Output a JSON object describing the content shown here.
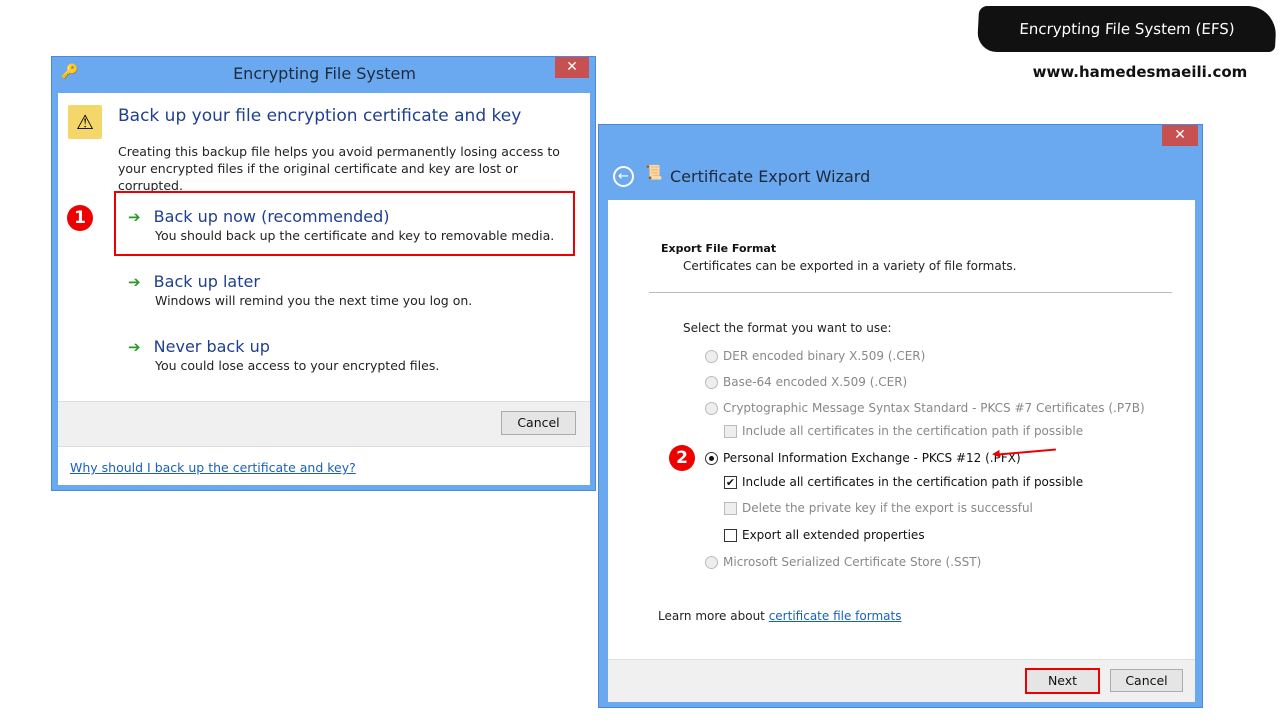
{
  "banner": {
    "title": "Encrypting File System (EFS)",
    "url": "www.hamedesmaeili.com"
  },
  "efs": {
    "title": "Encrypting File System",
    "close": "✕",
    "heading": "Back up your file encryption certificate and key",
    "description": "Creating this backup file helps you avoid permanently losing access to your encrypted files if the original certificate and key are lost or corrupted.",
    "step": "1",
    "options": [
      {
        "label": "Back up now (recommended)",
        "desc": "You should back up the certificate and key to removable media."
      },
      {
        "label": "Back up later",
        "desc": "Windows will remind you the next time you log on."
      },
      {
        "label": "Never back up",
        "desc": "You could lose access to your encrypted files."
      }
    ],
    "cancel": "Cancel",
    "help_link": "Why should I back up the certificate and key?"
  },
  "wizard": {
    "title": "Certificate Export Wizard",
    "close": "✕",
    "section_title": "Export File Format",
    "section_desc": "Certificates can be exported in a variety of file formats.",
    "prompt": "Select the format you want to use:",
    "step": "2",
    "formats": [
      {
        "label": "DER encoded binary X.509 (.CER)",
        "selected": false,
        "enabled": false
      },
      {
        "label": "Base-64 encoded X.509 (.CER)",
        "selected": false,
        "enabled": false
      },
      {
        "label": "Cryptographic Message Syntax Standard - PKCS #7 Certificates (.P7B)",
        "selected": false,
        "enabled": false
      },
      {
        "label": "Personal Information Exchange - PKCS #12 (.PFX)",
        "selected": true,
        "enabled": true
      },
      {
        "label": "Microsoft Serialized Certificate Store (.SST)",
        "selected": false,
        "enabled": false
      }
    ],
    "p7b_option": {
      "label": "Include all certificates in the certification path if possible",
      "checked": false,
      "enabled": false
    },
    "pfx_options": [
      {
        "label": "Include all certificates in the certification path if possible",
        "checked": true,
        "enabled": true
      },
      {
        "label": "Delete the private key if the export is successful",
        "checked": false,
        "enabled": false
      },
      {
        "label": "Export all extended properties",
        "checked": false,
        "enabled": true
      }
    ],
    "learn_more": "Learn more about",
    "learn_link": "certificate file formats",
    "next": "Next",
    "cancel": "Cancel"
  },
  "colors": {
    "titlebar": "#6aa9f0",
    "highlight": "#e00000"
  }
}
